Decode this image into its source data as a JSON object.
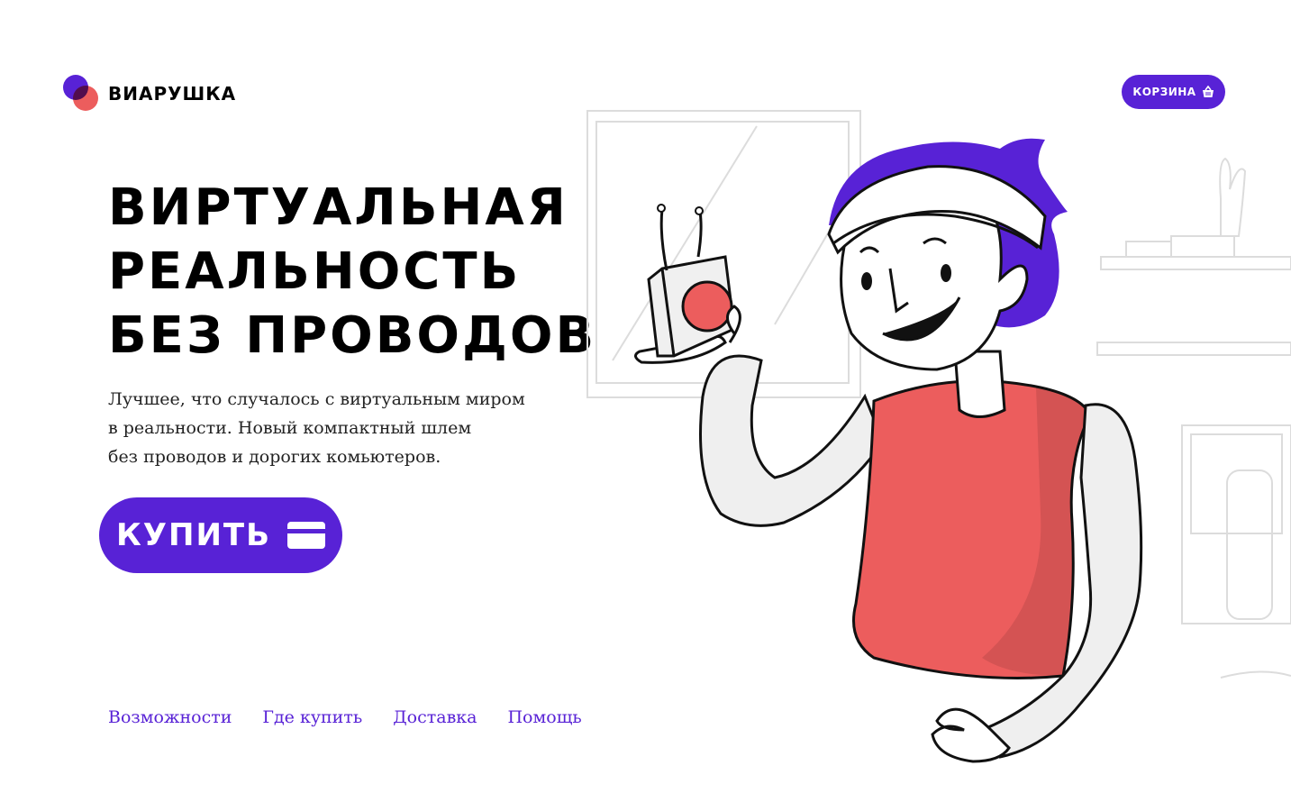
{
  "header": {
    "brand": "ВИАРУШКА",
    "cart_label": "КОРЗИНА"
  },
  "hero": {
    "title_lines": [
      "ВИРТУАЛЬНАЯ",
      "РЕАЛЬНОСТЬ",
      "БЕЗ ПРОВОДОВ"
    ],
    "description_lines": [
      "Лучшее, что случалось с виртуальным миром",
      "в реальности. Новый компактный шлем",
      "без проводов и дорогих комьютеров."
    ],
    "buy_label": "КУПИТЬ"
  },
  "nav": {
    "items": [
      "Возможности",
      "Где купить",
      "Доставка",
      "Помощь"
    ]
  },
  "colors": {
    "accent": "#5822d6",
    "coral": "#ec5d5d"
  },
  "icons": {
    "logo": "overlapping-circles-logo",
    "cart": "shopping-basket-icon",
    "buy": "credit-card-icon"
  }
}
